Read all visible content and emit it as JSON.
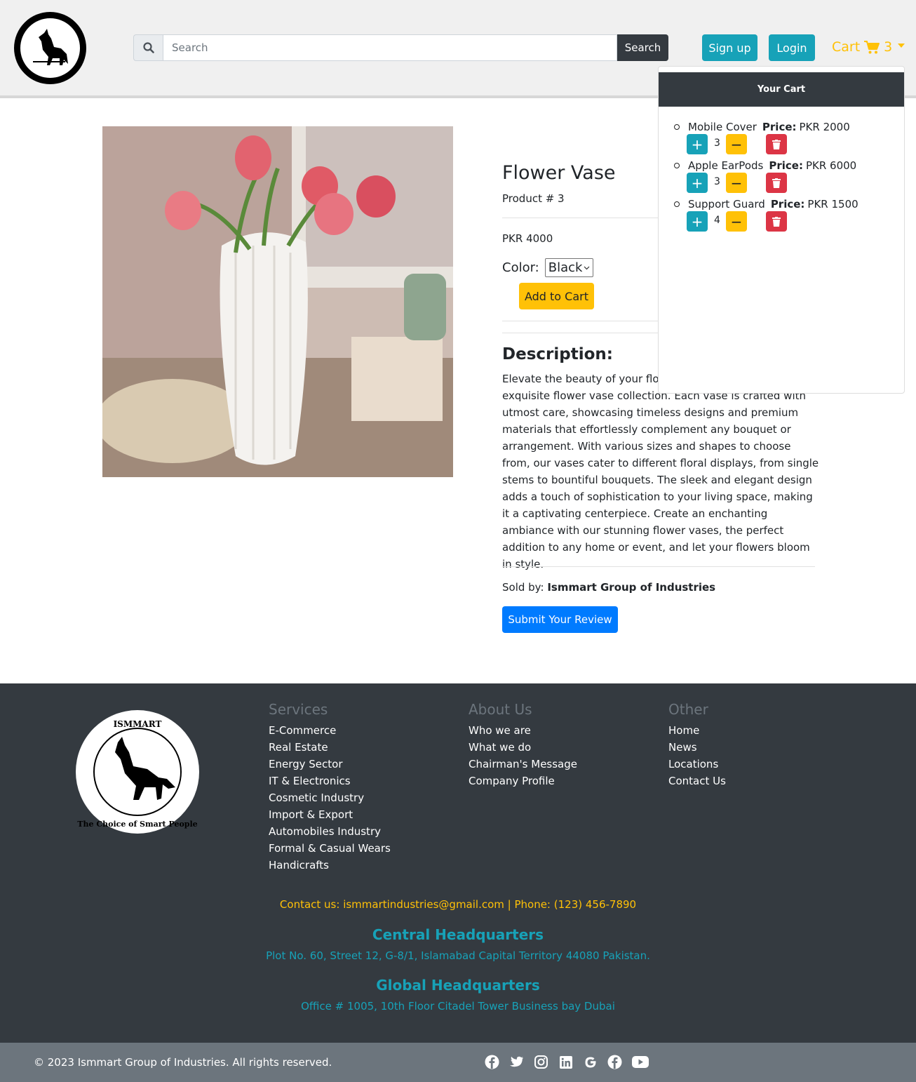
{
  "header": {
    "search_placeholder": "Search",
    "search_button": "Search",
    "signup_label": "Sign up",
    "login_label": "Login",
    "cart_label": "Cart",
    "cart_count": "3"
  },
  "cart": {
    "title": "Your Cart",
    "price_label": "Price:",
    "items": [
      {
        "name": "Mobile Cover",
        "price": "PKR 2000",
        "qty": "3"
      },
      {
        "name": "Apple EarPods",
        "price": "PKR 6000",
        "qty": "3"
      },
      {
        "name": "Support Guard",
        "price": "PKR 1500",
        "qty": "4"
      }
    ]
  },
  "product": {
    "title": "Flower Vase",
    "number": "Product # 3",
    "price": "PKR 4000",
    "color_label": "Color:",
    "color_value": "Black",
    "add_to_cart": "Add to Cart",
    "description_title": "Description:",
    "description": "Elevate the beauty of your floral arrangements with our exquisite flower vase collection. Each vase is crafted with utmost care, showcasing timeless designs and premium materials that effortlessly complement any bouquet or arrangement. With various sizes and shapes to choose from, our vases cater to different floral displays, from single stems to bountiful bouquets. The sleek and elegant design adds a touch of sophistication to your living space, making it a captivating centerpiece. Create an enchanting ambiance with our stunning flower vases, the perfect addition to any home or event, and let your flowers bloom in style.",
    "sold_by_label": "Sold by:",
    "seller": "Ismmart Group of Industries",
    "review_button": "Submit Your Review"
  },
  "footer": {
    "services": {
      "title": "Services",
      "links": [
        "E-Commerce",
        "Real Estate",
        "Energy Sector",
        "IT & Electronics",
        "Cosmetic Industry",
        "Import & Export",
        "Automobiles Industry",
        "Formal & Casual Wears",
        "Handicrafts"
      ]
    },
    "about": {
      "title": "About Us",
      "links": [
        "Who we are",
        "What we do",
        "Chairman's Message",
        "Company Profile"
      ]
    },
    "other": {
      "title": "Other",
      "links": [
        "Home",
        "News",
        "Locations",
        "Contact Us"
      ]
    },
    "contact": "Contact us: ismmartindustries@gmail.com | Phone: (123) 456-7890",
    "central_hq_title": "Central Headquarters",
    "central_hq_address": "Plot No. 60, Street 12, G-8/1, Islamabad Capital Territory 44080 Pakistan.",
    "global_hq_title": "Global Headquarters",
    "global_hq_address": "Office # 1005, 10th Floor Citadel Tower Business bay Dubai",
    "copyright": "© 2023 Ismmart Group of Industries. All rights reserved.",
    "social_icons": [
      "facebook-icon",
      "twitter-icon",
      "instagram-icon",
      "linkedin-icon",
      "google-icon",
      "facebook-icon",
      "youtube-icon"
    ]
  },
  "colors": {
    "teal": "#17a2b8",
    "yellow": "#ffc107",
    "red": "#dc3545",
    "blue": "#007bff",
    "dark": "#343a40",
    "gray": "#6c757d"
  }
}
